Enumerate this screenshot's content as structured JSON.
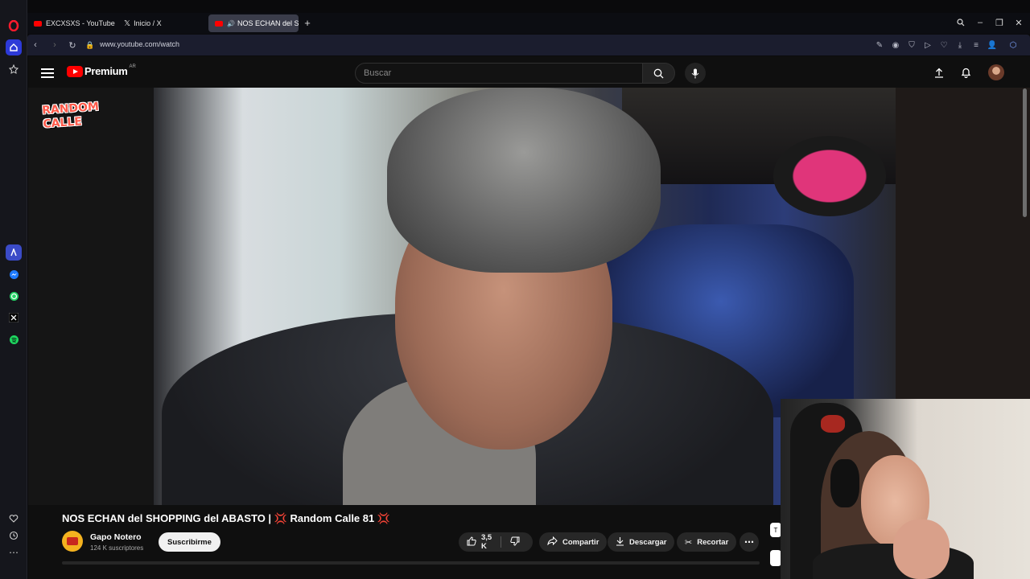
{
  "browser": {
    "tabs": [
      {
        "label": "EXCXSXS - YouTube",
        "favicon_color": "#ff0000"
      },
      {
        "label": "Inicio / X",
        "favicon_color": "#ffffff"
      },
      {
        "label": "NOS ECHAN del SHOP",
        "favicon_color": "#ff0000",
        "active": true
      }
    ],
    "url": "www.youtube.com/watch"
  },
  "youtube": {
    "logo_text": "Premium",
    "country_code": "AR",
    "search_placeholder": "Buscar"
  },
  "video": {
    "watermark_line1": "RANDOM",
    "watermark_line2": "CALLE",
    "title": "NOS ECHAN del SHOPPING del ABASTO | 💢 Random Calle 81 💢",
    "channel_name": "Gapo Notero",
    "subscribers": "124 K suscriptores",
    "subscribe_label": "Suscribirme",
    "like_count": "3,5 K",
    "share_label": "Compartir",
    "download_label": "Descargar",
    "clip_label": "Recortar",
    "side_badge": "T"
  },
  "colors": {
    "accent": "#ff0000",
    "opera": "#ff1b2d"
  }
}
